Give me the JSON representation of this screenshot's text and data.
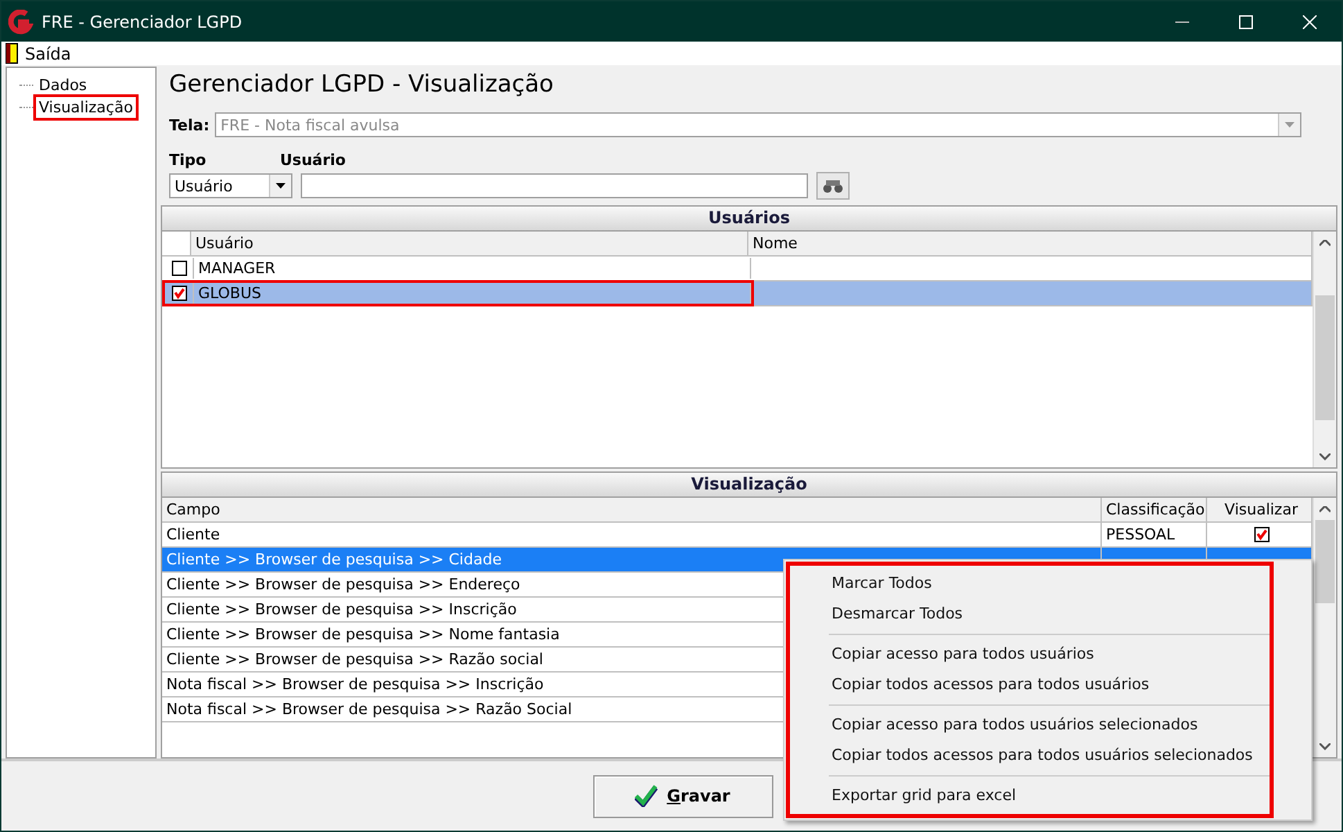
{
  "window": {
    "title": "FRE - Gerenciador LGPD"
  },
  "menu_bar": [
    {
      "label": "Saída"
    }
  ],
  "tree": [
    {
      "label": "Dados",
      "highlighted": false
    },
    {
      "label": "Visualização",
      "highlighted": true
    }
  ],
  "heading": "Gerenciador LGPD - Visualização",
  "tela": {
    "label": "Tela:",
    "value": "FRE - Nota fiscal avulsa",
    "disabled": true
  },
  "tipo": {
    "label": "Tipo",
    "value": "Usuário"
  },
  "usuario": {
    "label": "Usuário"
  },
  "users_grid": {
    "title": "Usuários",
    "columns": [
      "Usuário",
      "Nome"
    ],
    "rows": [
      {
        "usuario": "MANAGER",
        "checked": false,
        "selected": false,
        "highlighted": false
      },
      {
        "usuario": "GLOBUS",
        "checked": true,
        "selected": true,
        "highlighted": true
      }
    ]
  },
  "fields_grid": {
    "title": "Visualização",
    "columns": [
      "Campo",
      "Classificação",
      "Visualizar"
    ],
    "rows": [
      {
        "campo": "Cliente",
        "classificacao": "PESSOAL",
        "visualizar": true,
        "selected": false
      },
      {
        "campo": "Cliente >> Browser de pesquisa >> Cidade",
        "selected": true
      },
      {
        "campo": "Cliente >> Browser de pesquisa >> Endereço",
        "selected": false
      },
      {
        "campo": "Cliente >> Browser de pesquisa >> Inscrição",
        "selected": false
      },
      {
        "campo": "Cliente >> Browser de pesquisa >> Nome fantasia",
        "selected": false
      },
      {
        "campo": "Cliente >> Browser de pesquisa >> Razão social",
        "selected": false
      },
      {
        "campo": "Nota fiscal >> Browser de pesquisa >> Inscrição",
        "selected": false
      },
      {
        "campo": "Nota fiscal >> Browser de pesquisa >> Razão Social",
        "selected": false
      }
    ]
  },
  "context_menu": {
    "highlighted": true,
    "groups": [
      [
        "Marcar Todos",
        "Desmarcar Todos"
      ],
      [
        "Copiar acesso para todos usuários",
        "Copiar todos acessos para todos usuários"
      ],
      [
        "Copiar acesso para todos usuários selecionados",
        "Copiar todos acessos para todos usuários selecionados"
      ],
      [
        "Exportar grid para excel"
      ]
    ]
  },
  "buttons": [
    {
      "label": "Gravar"
    }
  ]
}
